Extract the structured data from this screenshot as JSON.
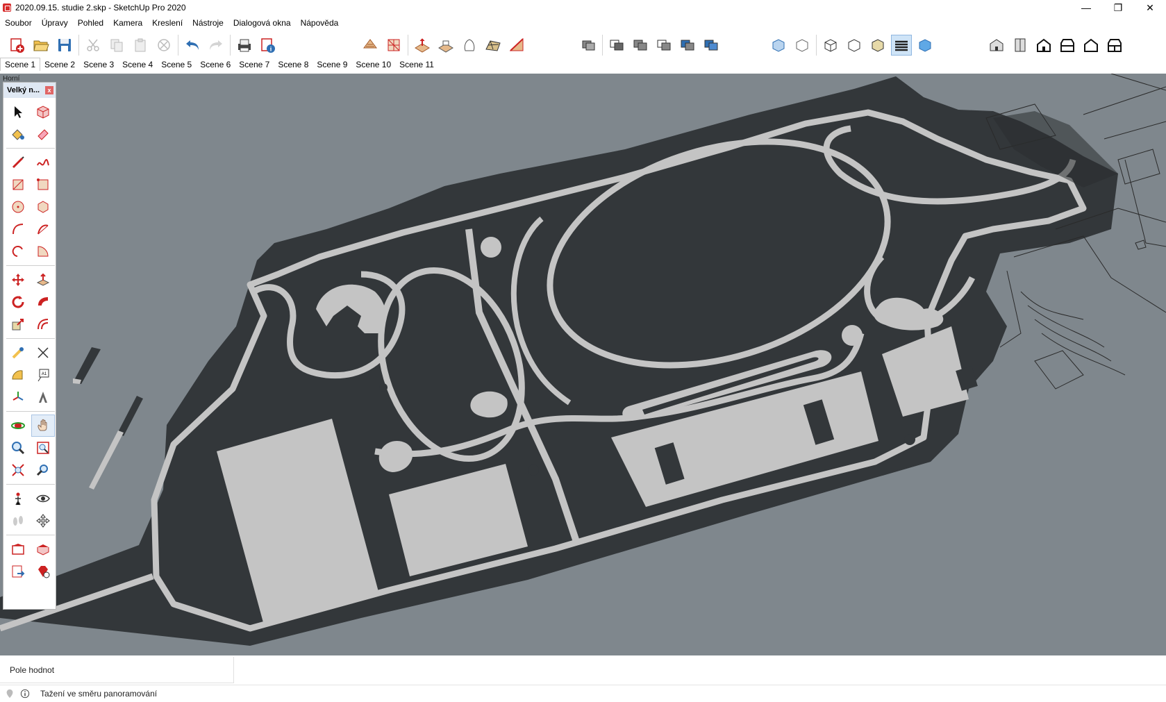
{
  "window": {
    "title": "2020.09.15. studie 2.skp - SketchUp Pro 2020",
    "minimize": "—",
    "restore": "❐",
    "close": "✕"
  },
  "menu": [
    "Soubor",
    "Úpravy",
    "Pohled",
    "Kamera",
    "Kreslení",
    "Nástroje",
    "Dialogová okna",
    "Nápověda"
  ],
  "scenes": [
    "Scene 1",
    "Scene 2",
    "Scene 3",
    "Scene 4",
    "Scene 5",
    "Scene 6",
    "Scene 7",
    "Scene 8",
    "Scene 9",
    "Scene 10",
    "Scene 11"
  ],
  "viewport": {
    "view_label": "Horní",
    "background": "#7f878d",
    "dark_fill": "#33373a",
    "light_fill": "#c4c4c4"
  },
  "palette": {
    "title": "Velký n...",
    "close": "x"
  },
  "value_field": {
    "label": "Pole hodnot"
  },
  "status": {
    "text": "Tažení ve směru panoramování"
  },
  "toolbar_icons": {
    "file": [
      "new-model-icon",
      "open-icon",
      "save-icon",
      "cut-icon",
      "copy-icon",
      "paste-icon",
      "erase-icon",
      "undo-icon",
      "redo-icon",
      "print-icon",
      "model-info-icon"
    ],
    "sandbox": [
      "from-contours-icon",
      "from-scratch-icon",
      "smoove-icon",
      "stamp-icon",
      "drape-icon",
      "add-detail-icon",
      "flip-edge-icon"
    ],
    "solid": [
      "outer-shell-icon",
      "intersect-icon",
      "union-icon",
      "subtract-icon",
      "trim-icon",
      "split-icon"
    ],
    "style": [
      "xray-icon",
      "back-edges-icon",
      "wireframe-icon",
      "hidden-line-icon",
      "shaded-icon",
      "shaded-textures-icon",
      "monochrome-icon"
    ],
    "views": [
      "iso-icon",
      "top-icon",
      "front-icon",
      "right-icon",
      "back-icon",
      "left-icon"
    ]
  },
  "accent": "#d72c2c"
}
